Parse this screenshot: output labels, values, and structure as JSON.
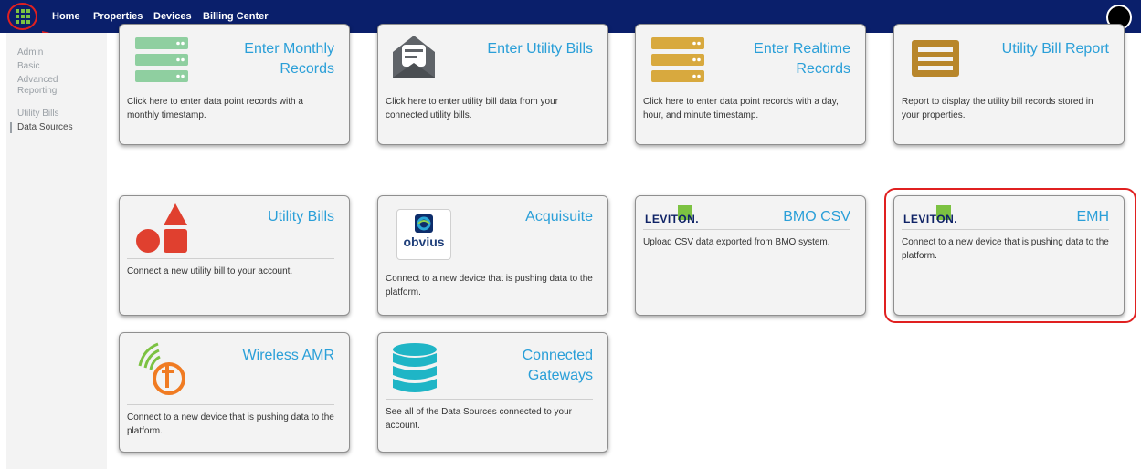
{
  "topbar": {
    "nav": [
      "Home",
      "Properties",
      "Devices",
      "Billing Center"
    ],
    "app_grid_icon": "grid-icon",
    "avatar_icon": "user-avatar-icon",
    "brand_color": "#0a1f6b"
  },
  "sidebar": {
    "items": [
      "Admin",
      "Basic",
      "Advanced Reporting",
      "Utility Bills",
      "Data Sources"
    ],
    "active": "Data Sources"
  },
  "cards": [
    {
      "title": "Enter Monthly Records",
      "desc": "Click here to enter data point records with a monthly timestamp.",
      "icon": "server-stack-green-icon"
    },
    {
      "title": "Enter Utility Bills",
      "desc": "Click here to enter utility bill data from your connected utility bills.",
      "icon": "envelope-bill-icon"
    },
    {
      "title": "Enter Realtime Records",
      "desc": "Click here to enter data point records with a day, hour, and minute timestamp.",
      "icon": "server-stack-gold-icon"
    },
    {
      "title": "Utility Bill Report",
      "desc": "Report to display the utility bill records stored in your properties.",
      "icon": "report-document-icon"
    },
    {
      "title": "Utility Bills",
      "desc": "Connect a new utility bill to your account.",
      "icon": "shapes-icon"
    },
    {
      "title": "Acquisuite",
      "desc": "Connect to a new device that is pushing data to the platform.",
      "icon": "obvius-logo",
      "logo_text": "obvius"
    },
    {
      "title": "BMO CSV",
      "desc": "Upload CSV data exported from BMO system.",
      "icon": "leviton-logo",
      "logo_text": "LEVITON."
    },
    {
      "title": "EMH",
      "desc": "Connect to a new device that is pushing data to the platform.",
      "icon": "leviton-logo",
      "logo_text": "LEVITON."
    },
    {
      "title": "Wireless AMR",
      "desc": "Connect to a new device that is pushing data to the platform.",
      "icon": "wireless-amr-logo"
    },
    {
      "title": "Connected Gateways",
      "desc": "See all of the Data Sources connected to your account.",
      "icon": "database-icon"
    }
  ],
  "colors": {
    "title_blue": "#2a9fd8",
    "highlight_red": "#e02020",
    "leviton_green": "#7cc242"
  }
}
